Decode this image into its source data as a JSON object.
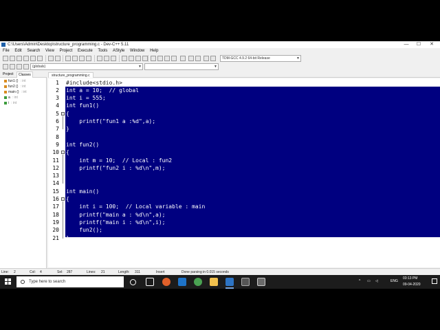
{
  "window": {
    "title": "C:\\Users\\Admin\\Desktop\\structure_programming.c - Dev-C++ 5.11",
    "minimize_glyph": "—",
    "maximize_glyph": "☐",
    "close_glyph": "✕"
  },
  "menu": [
    "File",
    "Edit",
    "Search",
    "View",
    "Project",
    "Execute",
    "Tools",
    "AStyle",
    "Window",
    "Help"
  ],
  "toolbar": {
    "compiler": "TDM-GCC 4.9.2 64-bit Release",
    "scope": "(globals)"
  },
  "left_panel": {
    "tabs": [
      "Project",
      "Classes"
    ],
    "active_tab": "Classes",
    "items": [
      {
        "name": "fun1 ()",
        "type": ": int"
      },
      {
        "name": "fun2 ()",
        "type": ": int"
      },
      {
        "name": "main ()",
        "type": ": int"
      },
      {
        "name": "a",
        "type": ": int"
      },
      {
        "name": "i",
        "type": ": int"
      }
    ]
  },
  "editor": {
    "file_tab": "structure_programming.c",
    "line_numbers": [
      "1",
      "2",
      "3",
      "4",
      "5",
      "6",
      "7",
      "8",
      "9",
      "10",
      "11",
      "12",
      "13",
      "14",
      "15",
      "16",
      "17",
      "18",
      "19",
      "20",
      "21"
    ],
    "lines": [
      "#include<stdio.h>",
      "int a = 10;  // global",
      "int i = 555;",
      "int fun1()",
      "{",
      "    printf(\"fun1 a :%d\",a);",
      "}",
      "",
      "int fun2()",
      "{",
      "    int m = 10;  // Local : fun2",
      "    printf(\"fun2 i : %d\\n\",m);",
      "",
      "",
      "int main()",
      "{",
      "    int i = 100;  // Local variable : main",
      "    printf(\"main a : %d\\n\",a);",
      "    printf(\"main i : %d\\n\",i);",
      "    fun2();",
      "}"
    ]
  },
  "statusbar": {
    "line": "Line:",
    "line_val": "2",
    "col": "Col:",
    "col_val": "4",
    "sel": "Sel:",
    "sel_val": "287",
    "lines": "Lines:",
    "lines_val": "21",
    "length": "Length:",
    "length_val": "311",
    "mode": "Insert",
    "message": "Done parsing in 0.015 seconds"
  },
  "taskbar": {
    "search_placeholder": "Type here to search",
    "lang": "ENG",
    "time": "03:13 PM",
    "date": "09-04-2020"
  },
  "colors": {
    "selection": "#000080",
    "taskbar": "#1c1c1c"
  }
}
